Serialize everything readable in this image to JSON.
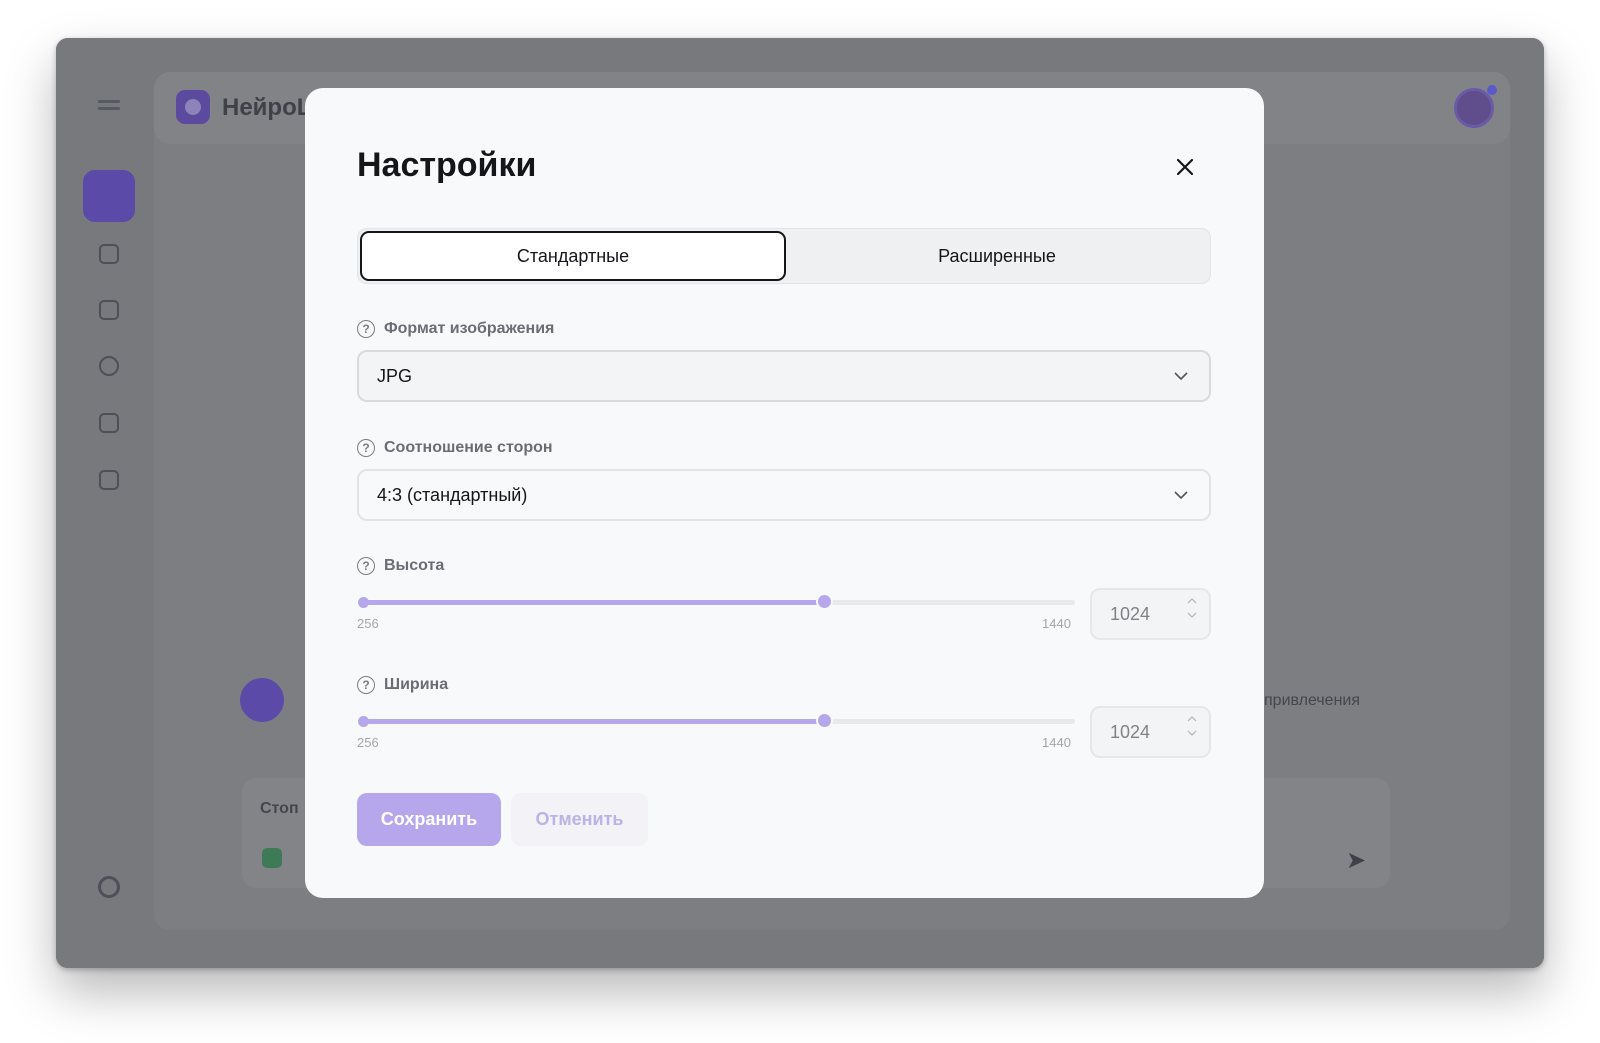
{
  "background_app": {
    "logo_text": "НейроL",
    "chat_snippet_right": "привлечения",
    "input_snippet": "Стоп"
  },
  "modal": {
    "title": "Настройки",
    "tabs": [
      {
        "label": "Стандартные",
        "active": true
      },
      {
        "label": "Расширенные",
        "active": false
      }
    ],
    "fields": {
      "format": {
        "label": "Формат изображения",
        "value": "JPG"
      },
      "aspect": {
        "label": "Соотношение сторон",
        "value": "4:3 (стандартный)"
      },
      "height": {
        "label": "Высота",
        "min": "256",
        "max": "1440",
        "value": "1024",
        "fraction": 0.6486
      },
      "width": {
        "label": "Ширина",
        "min": "256",
        "max": "1440",
        "value": "1024",
        "fraction": 0.6486
      }
    },
    "buttons": {
      "save": "Сохранить",
      "cancel": "Отменить"
    }
  },
  "colors": {
    "accent": "#b6a6ec",
    "overlay": "#78797c",
    "brand_purple": "#5b4aa8"
  }
}
